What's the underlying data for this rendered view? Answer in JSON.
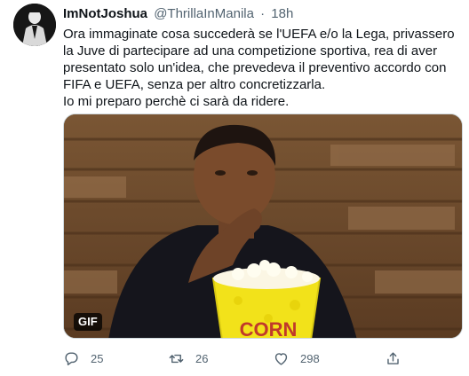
{
  "tweet": {
    "display_name": "ImNotJoshua",
    "handle": "@ThrillaInManila",
    "separator": "·",
    "time": "18h",
    "text_lines": [
      "Ora immaginate cosa succederà se l'UEFA e/o la Lega, privassero la Juve di partecipare ad una competizione sportiva, rea di aver presentato solo un'idea, che prevedeva il preventivo accordo con FIFA e UEFA, senza per altro concretizzarla.",
      "Io mi preparo perchè ci sarà da ridere."
    ],
    "media": {
      "badge": "GIF",
      "popcorn_text": "CORN"
    },
    "actions": {
      "reply_count": "25",
      "retweet_count": "26",
      "like_count": "298"
    }
  },
  "colors": {
    "text_primary": "#0f1419",
    "text_secondary": "#536471",
    "border": "#cfd9de",
    "popcorn_yellow": "#f2e21a"
  },
  "icons": [
    "avatar-image",
    "reply-icon",
    "retweet-icon",
    "like-icon",
    "share-icon"
  ]
}
